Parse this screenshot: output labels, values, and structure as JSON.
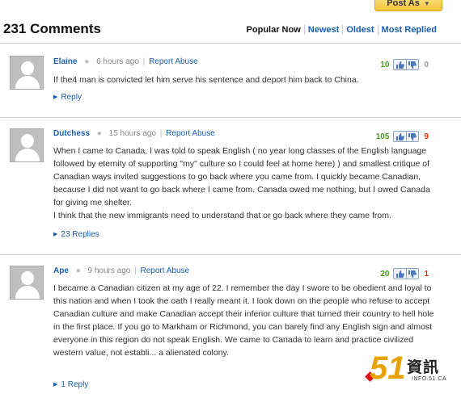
{
  "top": {
    "post_as_label": "Post As"
  },
  "header": {
    "title": "231 Comments",
    "sort_options": [
      "Popular Now",
      "Newest",
      "Oldest",
      "Most Replied"
    ]
  },
  "comments": [
    {
      "user": "Elaine",
      "time": "6 hours ago",
      "report": "Report Abuse",
      "up": "10",
      "down": "0",
      "paragraphs": [
        "If the4 man is convicted let him serve his sentence and deport him back to China."
      ],
      "reply_label": "Reply"
    },
    {
      "user": "Dutchess",
      "time": "15 hours ago",
      "report": "Report Abuse",
      "up": "105",
      "down": "9",
      "paragraphs": [
        "When I came to Canada, I was told to speak English ( no year long classes of the English language followed by eternity of supporting \"my\" culture so I could feel at home here) ) and smallest critique of Canadian ways invited suggestions to go back where you came from. I quickly became Canadian, because I did not want to go back where I came from. Canada owed me nothing, but I owed Canada for giving me shelter.",
        "I think that the new immigrants need to understand that or go back where they came from."
      ],
      "reply_label": "23 Replies"
    },
    {
      "user": "Ape",
      "time": "9 hours ago",
      "report": "Report Abuse",
      "up": "20",
      "down": "1",
      "paragraphs": [
        "I became a Canadian citizen at my age of 22. I remember the day I swore to be obedient and loyal to this nation and when I took the oath I really meant it. I look down on the people who refuse to accept Canadian culture and make Canadian accept their inferior culture that turned their country to hell hole in the first place. If you go to Markham or Richmond, you can barely find any English sign and almost everyone in this region do not speak English. We came to Canada to learn and practice civilized western value, not establi... a alienated colony."
      ],
      "reply_label": "1 Reply"
    }
  ],
  "watermark": {
    "number": "51",
    "chinese": "資訊",
    "site": "INFO.51.CA"
  }
}
